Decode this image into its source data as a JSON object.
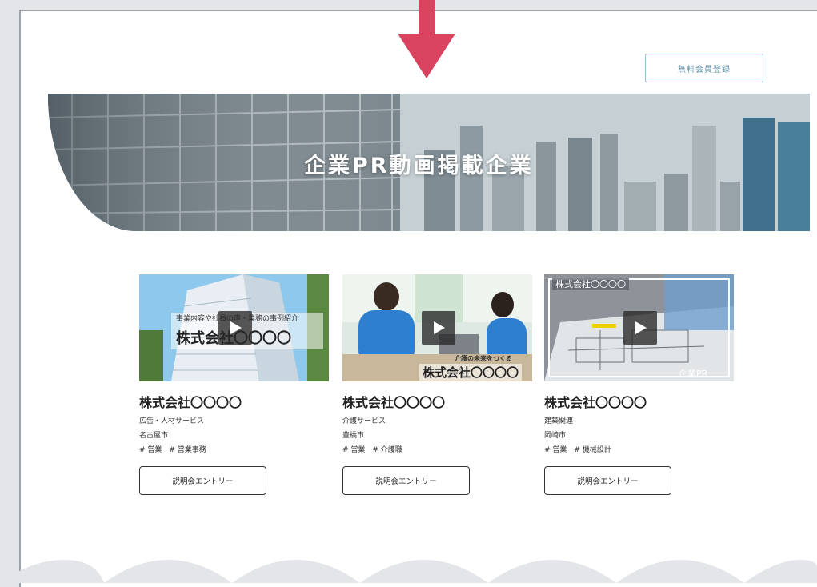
{
  "header": {
    "signup_label": "無料会員登録"
  },
  "hero": {
    "title": "企業PR動画掲載企業"
  },
  "cards": [
    {
      "thumb_caption_top": "事業内容や社員の声・業務の事例紹介",
      "thumb_caption_main": "株式会社〇〇〇〇",
      "company": "株式会社〇〇〇〇",
      "industry": "広告・人材サービス",
      "city": "名古屋市",
      "tags": "# 営業　# 営業事務",
      "entry_label": "説明会エントリー"
    },
    {
      "thumb_caption_top": "介護の未来をつくる",
      "thumb_caption_main": "株式会社〇〇〇〇",
      "company": "株式会社〇〇〇〇",
      "industry": "介護サービス",
      "city": "豊橋市",
      "tags": "# 営業　# 介護職",
      "entry_label": "説明会エントリー"
    },
    {
      "thumb_caption_top": "株式会社〇〇〇〇",
      "thumb_caption_main": "企業PR",
      "company": "株式会社〇〇〇〇",
      "industry": "建築関連",
      "city": "岡崎市",
      "tags": "# 営業　# 機械設計",
      "entry_label": "説明会エントリー"
    }
  ],
  "colors": {
    "arrow": "#d9435f",
    "button_border": "#8fc3d8",
    "page_bg": "#e3e5e8"
  }
}
